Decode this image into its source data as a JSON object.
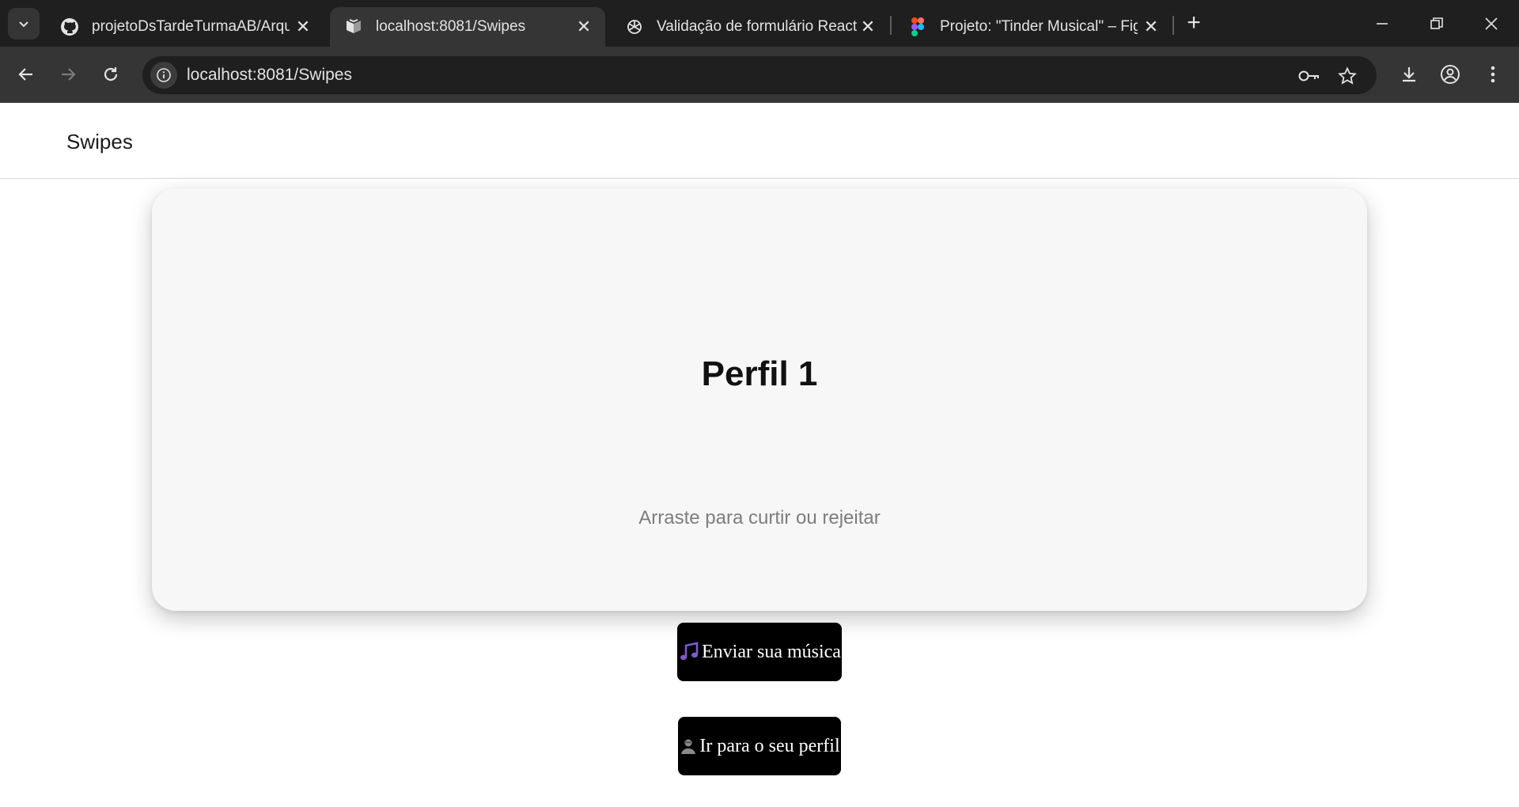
{
  "browser": {
    "tabs": [
      {
        "title": "projetoDsTardeTurmaAB/Arquiv",
        "icon": "github-icon"
      },
      {
        "title": "localhost:8081/Swipes",
        "icon": "expo-icon",
        "active": true
      },
      {
        "title": "Validação de formulário React",
        "icon": "openai-icon"
      },
      {
        "title": "Projeto: \"Tinder Musical\" – Figm",
        "icon": "figma-icon"
      }
    ],
    "url": "localhost:8081/Swipes"
  },
  "header": {
    "title": "Swipes"
  },
  "card": {
    "name": "Perfil 1",
    "hint": "Arraste para curtir ou rejeitar",
    "background": "#f7f7f7"
  },
  "actions": {
    "send_music": {
      "icon": "music-note-icon",
      "label": "Enviar sua música"
    },
    "go_profile": {
      "icon": "user-silhouette-icon",
      "label": "Ir para o seu perfil"
    }
  },
  "colors": {
    "chrome_dark": "#1f1f1f",
    "chrome_toolbar": "#353535",
    "button_bg": "#000000",
    "button_text": "#ffffff",
    "music_icon": "#7c5cc9"
  }
}
